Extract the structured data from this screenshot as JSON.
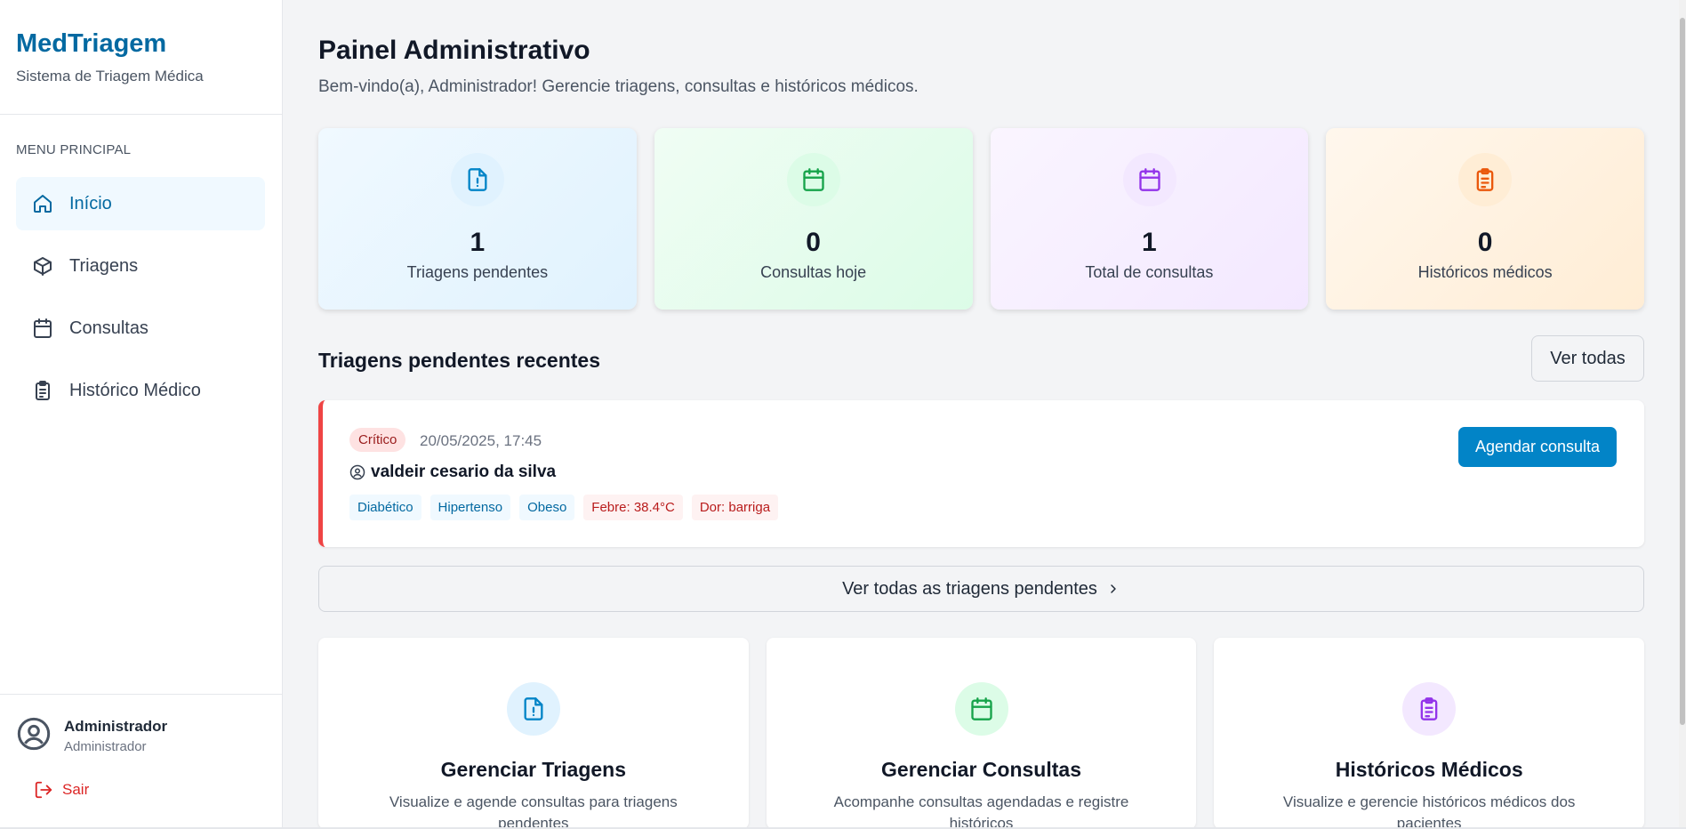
{
  "brand": {
    "title": "MedTriagem",
    "subtitle": "Sistema de Triagem Médica"
  },
  "sidebar": {
    "heading": "MENU PRINCIPAL",
    "items": [
      {
        "label": "Início",
        "icon": "home-icon",
        "active": true
      },
      {
        "label": "Triagens",
        "icon": "box-icon",
        "active": false
      },
      {
        "label": "Consultas",
        "icon": "calendar-icon",
        "active": false
      },
      {
        "label": "Histórico Médico",
        "icon": "clipboard-icon",
        "active": false
      }
    ],
    "user": {
      "name": "Administrador",
      "role": "Administrador"
    },
    "logout": "Sair"
  },
  "header": {
    "title": "Painel Administrativo",
    "subtitle": "Bem-vindo(a), Administrador! Gerencie triagens, consultas e históricos médicos."
  },
  "stats": [
    {
      "value": "1",
      "label": "Triagens pendentes",
      "icon": "file-alert-icon",
      "color": "#0284c7"
    },
    {
      "value": "0",
      "label": "Consultas hoje",
      "icon": "calendar-icon",
      "color": "#16a34a"
    },
    {
      "value": "1",
      "label": "Total de consultas",
      "icon": "calendar-icon",
      "color": "#9333ea"
    },
    {
      "value": "0",
      "label": "Históricos médicos",
      "icon": "clipboard-icon",
      "color": "#ea580c"
    }
  ],
  "recent": {
    "title": "Triagens pendentes recentes",
    "view_all": "Ver todas",
    "triage": {
      "severity": "Crítico",
      "datetime": "20/05/2025, 17:45",
      "patient": "valdeir cesario da silva",
      "tags": [
        "Diabético",
        "Hipertenso",
        "Obeso"
      ],
      "symptoms": [
        "Febre: 38.4°C",
        "Dor: barriga"
      ],
      "action": "Agendar consulta"
    },
    "view_pending": "Ver todas as triagens pendentes"
  },
  "actions": [
    {
      "title": "Gerenciar Triagens",
      "description": "Visualize e agende consultas para triagens pendentes",
      "icon": "file-alert-icon",
      "color": "#0284c7"
    },
    {
      "title": "Gerenciar Consultas",
      "description": "Acompanhe consultas agendadas e registre históricos",
      "icon": "calendar-icon",
      "color": "#16a34a"
    },
    {
      "title": "Históricos Médicos",
      "description": "Visualize e gerencie históricos médicos dos pacientes",
      "icon": "clipboard-icon",
      "color": "#9333ea"
    }
  ],
  "colors": {
    "primary": "#0369a1",
    "button": "#0284c7",
    "critical": "#ef4444",
    "logout": "#dc2626"
  }
}
